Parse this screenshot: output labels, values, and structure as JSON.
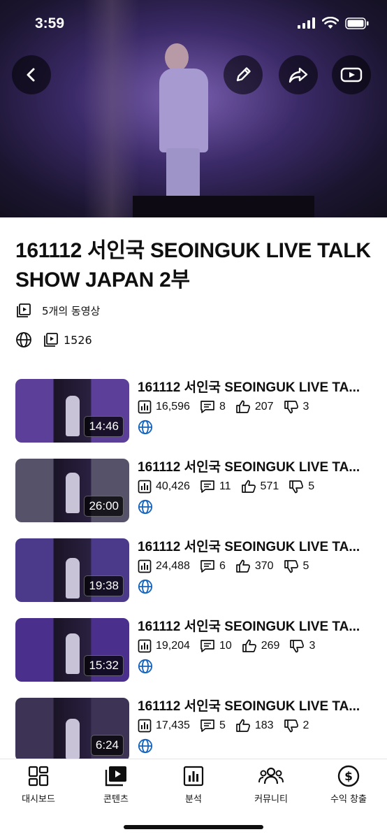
{
  "status_bar": {
    "time": "3:59"
  },
  "playlist": {
    "title": "161112 서인국 SEOINGUK LIVE TALK SHOW JAPAN 2부",
    "video_count": "5개의 동영상",
    "views": "1526",
    "visibility_icon": "globe-icon"
  },
  "videos": [
    {
      "title": "161112 서인국 SEOINGUK LIVE TA...",
      "duration": "14:46",
      "views": "16,596",
      "comments": "8",
      "likes": "207",
      "dislikes": "3",
      "thumb_color": "#5b3f98"
    },
    {
      "title": "161112 서인국 SEOINGUK LIVE TA...",
      "duration": "26:00",
      "views": "40,426",
      "comments": "11",
      "likes": "571",
      "dislikes": "5",
      "thumb_color": "#55526a"
    },
    {
      "title": "161112 서인국 SEOINGUK LIVE TA...",
      "duration": "19:38",
      "views": "24,488",
      "comments": "6",
      "likes": "370",
      "dislikes": "5",
      "thumb_color": "#4b3a8a"
    },
    {
      "title": "161112 서인국 SEOINGUK LIVE TA...",
      "duration": "15:32",
      "views": "19,204",
      "comments": "10",
      "likes": "269",
      "dislikes": "3",
      "thumb_color": "#4a2f8c"
    },
    {
      "title": "161112 서인국 SEOINGUK LIVE TA...",
      "duration": "6:24",
      "views": "17,435",
      "comments": "5",
      "likes": "183",
      "dislikes": "2",
      "thumb_color": "#3d3355"
    }
  ],
  "bottom_nav": [
    {
      "label": "대시보드",
      "icon": "dashboard-icon"
    },
    {
      "label": "콘텐츠",
      "icon": "content-icon"
    },
    {
      "label": "분석",
      "icon": "analytics-icon"
    },
    {
      "label": "커뮤니티",
      "icon": "community-icon"
    },
    {
      "label": "수익 창출",
      "icon": "monetization-icon"
    }
  ],
  "colors": {
    "link_blue": "#1565c0",
    "text": "#0f0f0f"
  }
}
